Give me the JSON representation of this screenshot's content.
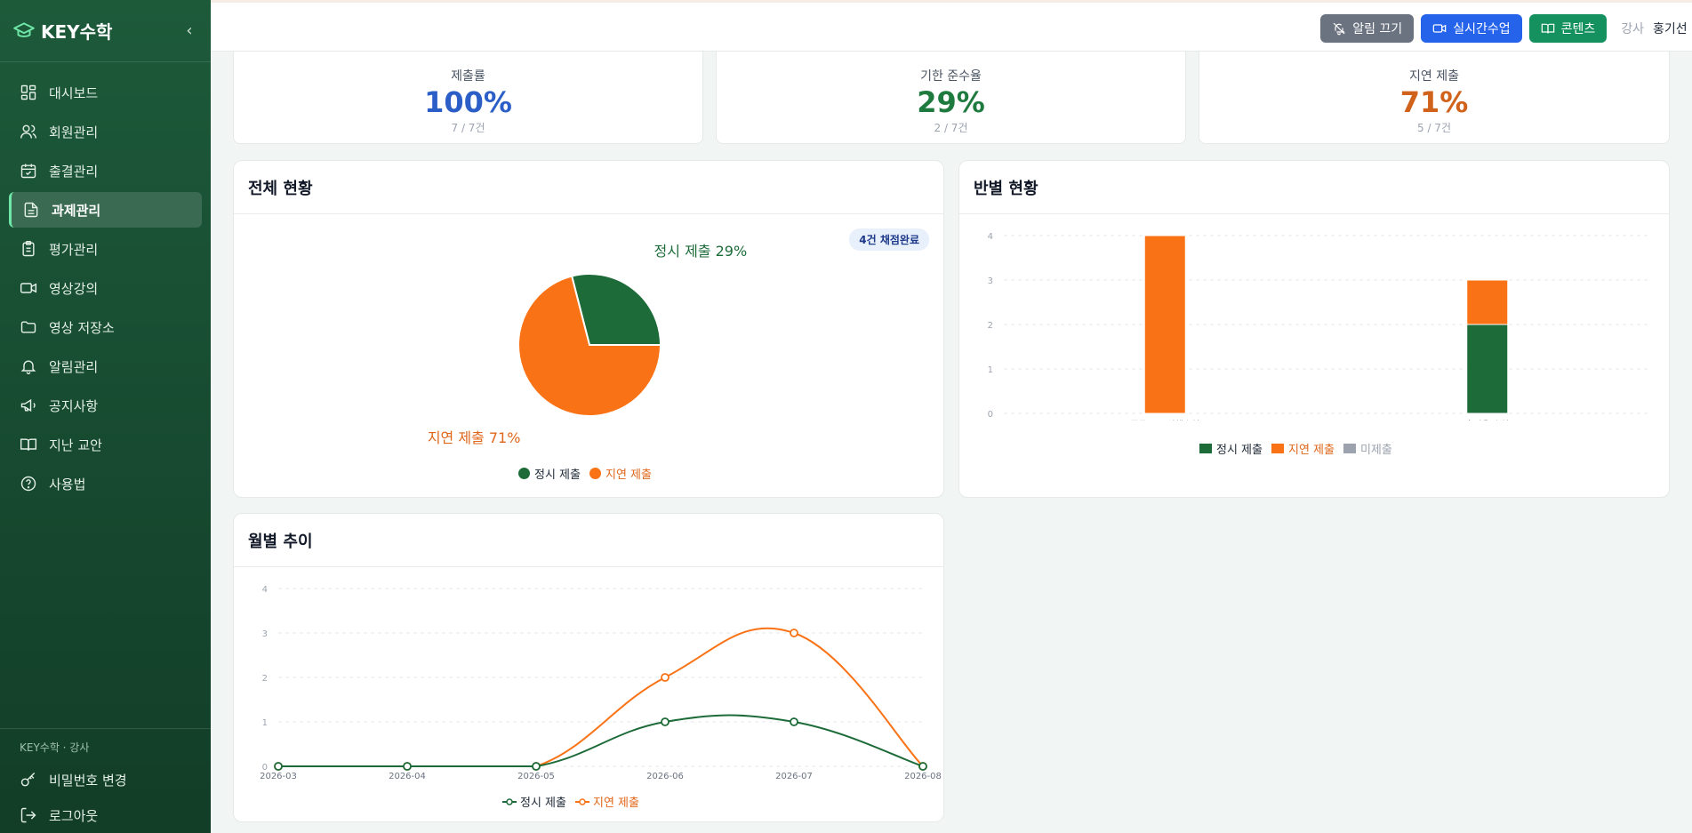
{
  "brand": {
    "name": "KEY수학"
  },
  "nav": [
    {
      "label": "대시보드",
      "icon": "dashboard-icon"
    },
    {
      "label": "회원관리",
      "icon": "users-icon"
    },
    {
      "label": "출결관리",
      "icon": "calendar-check-icon"
    },
    {
      "label": "과제관리",
      "icon": "document-icon",
      "active": true
    },
    {
      "label": "평가관리",
      "icon": "clipboard-icon"
    },
    {
      "label": "영상강의",
      "icon": "video-icon"
    },
    {
      "label": "영상 저장소",
      "icon": "folder-icon"
    },
    {
      "label": "알림관리",
      "icon": "bell-icon"
    },
    {
      "label": "공지사항",
      "icon": "megaphone-icon"
    },
    {
      "label": "지난 교안",
      "icon": "book-icon"
    },
    {
      "label": "사용법",
      "icon": "help-icon"
    }
  ],
  "sidebar_footer": {
    "role": "KEY수학 · 강사",
    "change_password": "비밀번호 변경",
    "logout": "로그아웃"
  },
  "topbar": {
    "mute_label": "알림 끄기",
    "live_label": "실시간수업",
    "content_label": "콘텐츠",
    "role": "강사",
    "user": "홍기선"
  },
  "stats": [
    {
      "label": "제출률",
      "value": "100%",
      "sub": "7 / 7건",
      "color": "#2b5fc7"
    },
    {
      "label": "기한 준수율",
      "value": "29%",
      "sub": "2 / 7건",
      "color": "#1f7a3f"
    },
    {
      "label": "지연 제출",
      "value": "71%",
      "sub": "5 / 7건",
      "color": "#d0621c"
    }
  ],
  "overall": {
    "title": "전체 현황",
    "badge": "4건 채점완료",
    "legend": [
      "정시 제출",
      "지연 제출"
    ]
  },
  "by_class": {
    "title": "반별 현황",
    "legend": [
      "정시 제출",
      "지연 제출",
      "미제출"
    ]
  },
  "monthly": {
    "title": "월별 추이",
    "legend": [
      "정시 제출",
      "지연 제출"
    ]
  },
  "colors": {
    "ontime": "#1d6b38",
    "late": "#f97316",
    "missing": "#9ca3af"
  },
  "chart_data": [
    {
      "type": "pie",
      "categories": [
        "정시 제출",
        "지연 제출"
      ],
      "values": [
        29,
        71
      ],
      "labels": [
        "정시 제출 29%",
        "지연 제출 71%"
      ]
    },
    {
      "type": "bar",
      "stacked": true,
      "categories": [
        "중등 1-2 선행수업",
        "홍지용 수업"
      ],
      "series": [
        {
          "name": "정시 제출",
          "values": [
            0,
            2
          ]
        },
        {
          "name": "지연 제출",
          "values": [
            4,
            1
          ]
        },
        {
          "name": "미제출",
          "values": [
            0,
            0
          ]
        }
      ],
      "yticks": [
        "0",
        "1",
        "2",
        "3",
        "4"
      ],
      "ylim": [
        0,
        4
      ],
      "grid": true,
      "legend": "bottom"
    },
    {
      "type": "line",
      "x": [
        "2026-03",
        "2026-04",
        "2026-05",
        "2026-06",
        "2026-07",
        "2026-08"
      ],
      "series": [
        {
          "name": "정시 제출",
          "values": [
            0,
            0,
            0,
            1,
            1,
            0
          ]
        },
        {
          "name": "지연 제출",
          "values": [
            0,
            0,
            0,
            2,
            3,
            0
          ]
        }
      ],
      "yticks": [
        "0",
        "1",
        "2",
        "3",
        "4"
      ],
      "ylim": [
        0,
        4
      ],
      "grid": true,
      "legend": "bottom"
    }
  ]
}
